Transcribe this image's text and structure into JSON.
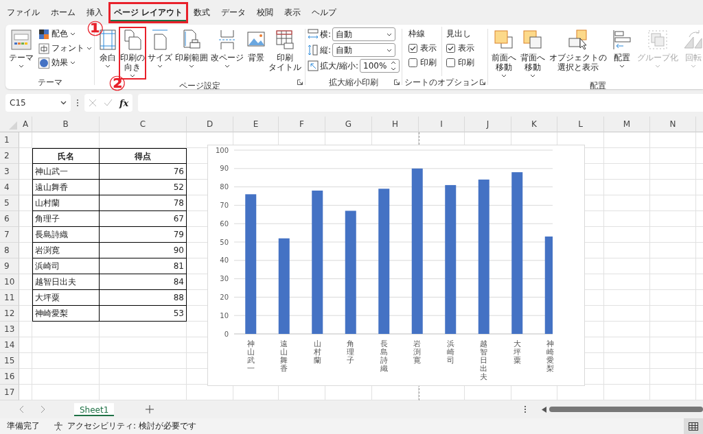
{
  "ribbon_tabs": [
    {
      "label": "ファイル",
      "selected": false,
      "highlighted": false
    },
    {
      "label": "ホーム",
      "selected": false,
      "highlighted": false
    },
    {
      "label": "挿入",
      "selected": false,
      "highlighted": false
    },
    {
      "label": "ページ レイアウト",
      "selected": true,
      "highlighted": true
    },
    {
      "label": "数式",
      "selected": false,
      "highlighted": false
    },
    {
      "label": "データ",
      "selected": false,
      "highlighted": false
    },
    {
      "label": "校閲",
      "selected": false,
      "highlighted": false
    },
    {
      "label": "表示",
      "selected": false,
      "highlighted": false
    },
    {
      "label": "ヘルプ",
      "selected": false,
      "highlighted": false
    }
  ],
  "theme_group": {
    "label": "テーマ",
    "big_button": {
      "label": "テーマ"
    },
    "items": [
      {
        "label": "配色",
        "caret": true
      },
      {
        "label": "フォント",
        "caret": true
      },
      {
        "label": "効果",
        "caret": true
      }
    ]
  },
  "page_setup_group": {
    "label": "ページ設定",
    "buttons": [
      {
        "lines": [
          "余白"
        ],
        "caret": true,
        "highlighted": false
      },
      {
        "lines": [
          "印刷の",
          "向き"
        ],
        "caret": true,
        "highlighted": true
      },
      {
        "lines": [
          "サイズ"
        ],
        "caret": true,
        "highlighted": false
      },
      {
        "lines": [
          "印刷範囲"
        ],
        "caret": true,
        "highlighted": false
      },
      {
        "lines": [
          "改ページ"
        ],
        "caret": true,
        "highlighted": false
      },
      {
        "lines": [
          "背景"
        ],
        "caret": false,
        "highlighted": false
      },
      {
        "lines": [
          "印刷",
          "タイトル"
        ],
        "caret": false,
        "highlighted": false
      }
    ]
  },
  "scale_group": {
    "label": "拡大縮小印刷",
    "fields": [
      {
        "label": "横:",
        "value": "自動",
        "kind": "dropdown"
      },
      {
        "label": "縦:",
        "value": "自動",
        "kind": "dropdown"
      },
      {
        "label": "拡大/縮小:",
        "value": "100%",
        "kind": "spinner"
      }
    ]
  },
  "sheet_options_group": {
    "label": "シートのオプション",
    "columns": [
      {
        "heading": "枠線",
        "options": [
          {
            "label": "表示",
            "checked": true
          },
          {
            "label": "印刷",
            "checked": false
          }
        ]
      },
      {
        "heading": "見出し",
        "options": [
          {
            "label": "表示",
            "checked": true
          },
          {
            "label": "印刷",
            "checked": false
          }
        ]
      }
    ]
  },
  "arrange_group": {
    "label": "配置",
    "buttons": [
      {
        "lines": [
          "前面へ",
          "移動"
        ],
        "caret": true,
        "disabled": false
      },
      {
        "lines": [
          "背面へ",
          "移動"
        ],
        "caret": true,
        "disabled": false
      },
      {
        "lines": [
          "オブジェクトの",
          "選択と表示"
        ],
        "caret": false,
        "disabled": false
      },
      {
        "lines": [
          "配置"
        ],
        "caret": true,
        "disabled": false
      },
      {
        "lines": [
          "グループ化"
        ],
        "caret": true,
        "disabled": true
      },
      {
        "lines": [
          "回転"
        ],
        "caret": true,
        "disabled": true
      }
    ]
  },
  "annotations": [
    {
      "label": "①"
    },
    {
      "label": "②"
    }
  ],
  "formula_bar": {
    "name_box": "C15",
    "function_label": "fx"
  },
  "columns": [
    "A",
    "B",
    "C",
    "D",
    "E",
    "F",
    "G",
    "H",
    "I",
    "J",
    "K",
    "L",
    "M",
    "N"
  ],
  "rows": [
    "1",
    "2",
    "3",
    "4",
    "5",
    "6",
    "7",
    "8",
    "9",
    "10",
    "11",
    "12",
    "13",
    "14",
    "15",
    "16",
    "17"
  ],
  "table": {
    "headers": [
      "氏名",
      "得点"
    ],
    "rows": [
      {
        "name": "神山武一",
        "score": "76"
      },
      {
        "name": "遠山舞香",
        "score": "52"
      },
      {
        "name": "山村蘭",
        "score": "78"
      },
      {
        "name": "角理子",
        "score": "67"
      },
      {
        "name": "長島詩織",
        "score": "79"
      },
      {
        "name": "岩渕寛",
        "score": "90"
      },
      {
        "name": "浜崎司",
        "score": "81"
      },
      {
        "name": "越智日出夫",
        "score": "84"
      },
      {
        "name": "大坪粟",
        "score": "88"
      },
      {
        "name": "神崎愛梨",
        "score": "53"
      }
    ]
  },
  "chart": {
    "chart_data": {
      "type": "bar",
      "categories": [
        "神山武一",
        "遠山舞香",
        "山村蘭",
        "角理子",
        "長島詩織",
        "岩渕寛",
        "浜崎司",
        "越智日出夫",
        "大坪粟",
        "神崎愛梨"
      ],
      "series": [
        {
          "color": "#4472c4",
          "values": [
            76,
            52,
            78,
            67,
            79,
            90,
            81,
            84,
            88,
            53
          ]
        }
      ],
      "grid": true,
      "ylim": [
        0,
        100
      ],
      "yticks": [
        0,
        10,
        20,
        30,
        40,
        50,
        60,
        70,
        80,
        90,
        100
      ]
    }
  },
  "sheet_tabs": [
    {
      "label": "Sheet1",
      "selected": true
    }
  ],
  "status_bar": {
    "ready": "準備完了",
    "accessibility": "アクセシビリティ: 検討が必要です"
  }
}
